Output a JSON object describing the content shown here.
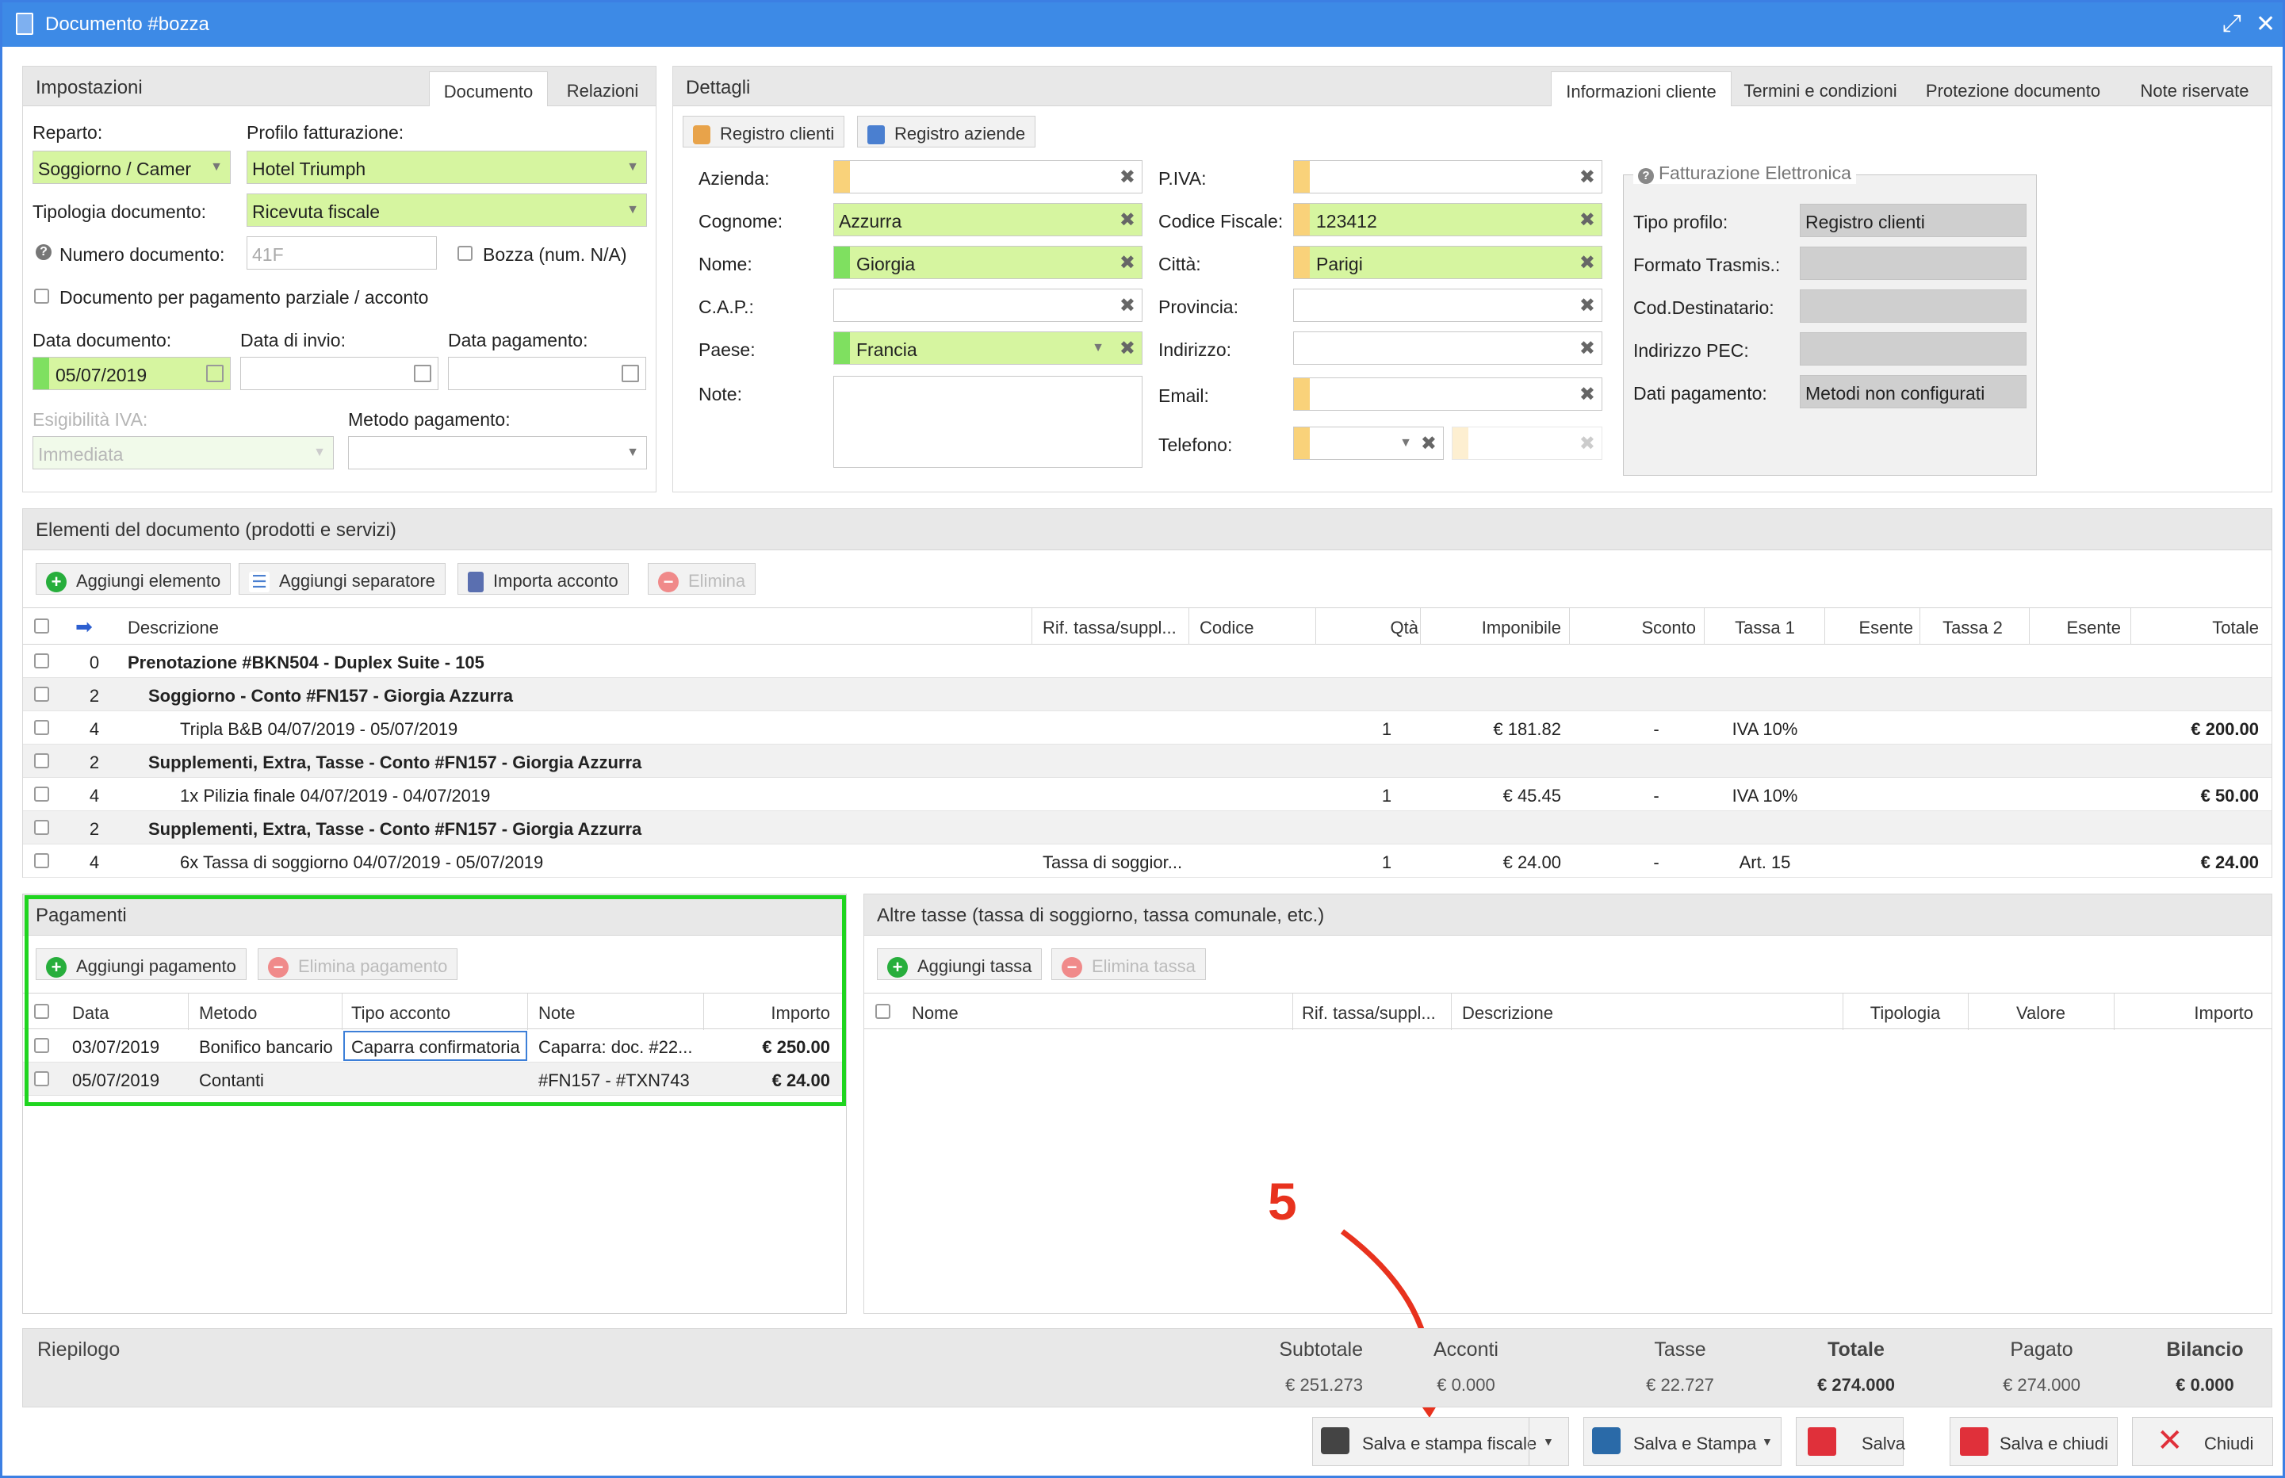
{
  "window": {
    "title": "Documento #bozza"
  },
  "impostazioni": {
    "title": "Impostazioni",
    "tabs": [
      "Documento",
      "Relazioni"
    ],
    "reparto_label": "Reparto:",
    "reparto_value": "Soggiorno / Camer",
    "profilo_label": "Profilo fatturazione:",
    "profilo_value": "Hotel Triumph",
    "tipologia_label": "Tipologia documento:",
    "tipologia_value": "Ricevuta fiscale",
    "numero_label": "Numero documento:",
    "numero_placeholder": "41F",
    "bozza_label": "Bozza (num. N/A)",
    "parziale_label": "Documento per pagamento parziale / acconto",
    "data_doc_label": "Data documento:",
    "data_doc_value": "05/07/2019",
    "data_invio_label": "Data di invio:",
    "data_pagamento_label": "Data pagamento:",
    "esigibilita_label": "Esigibilità IVA:",
    "esigibilita_value": "Immediata",
    "metodo_label": "Metodo pagamento:"
  },
  "dettagli": {
    "title": "Dettagli",
    "tabs": [
      "Informazioni cliente",
      "Termini e condizioni",
      "Protezione documento",
      "Note riservate"
    ],
    "registro_clienti": "Registro clienti",
    "registro_aziende": "Registro aziende",
    "azienda_label": "Azienda:",
    "cognome_label": "Cognome:",
    "cognome_value": "Azzurra",
    "nome_label": "Nome:",
    "nome_value": "Giorgia",
    "cap_label": "C.A.P.:",
    "paese_label": "Paese:",
    "paese_value": "Francia",
    "note_label": "Note:",
    "piva_label": "P.IVA:",
    "cf_label": "Codice Fiscale:",
    "cf_value": "123412",
    "citta_label": "Città:",
    "citta_value": "Parigi",
    "provincia_label": "Provincia:",
    "indirizzo_label": "Indirizzo:",
    "email_label": "Email:",
    "telefono_label": "Telefono:",
    "fe": {
      "title": "Fatturazione Elettronica",
      "tipo_label": "Tipo profilo:",
      "tipo_value": "Registro clienti",
      "formato_label": "Formato Trasmis.:",
      "cod_label": "Cod.Destinatario:",
      "pec_label": "Indirizzo PEC:",
      "pagamento_label": "Dati pagamento:",
      "pagamento_value": "Metodi non configurati"
    }
  },
  "elementi": {
    "title": "Elementi del documento (prodotti e servizi)",
    "buttons": {
      "add": "Aggiungi elemento",
      "sep": "Aggiungi separatore",
      "import": "Importa acconto",
      "del": "Elimina"
    },
    "headers": {
      "descr": "Descrizione",
      "rif": "Rif. tassa/suppl...",
      "codice": "Codice",
      "qta": "Qtà",
      "imponibile": "Imponibile",
      "sconto": "Sconto",
      "tassa1": "Tassa 1",
      "esente1": "Esente",
      "tassa2": "Tassa 2",
      "esente2": "Esente",
      "totale": "Totale"
    },
    "rows": [
      {
        "lvl": "0",
        "descr": "Prenotazione #BKN504 - Duplex Suite - 105",
        "bold": true,
        "indent": 0,
        "alt": false
      },
      {
        "lvl": "2",
        "descr": "Soggiorno - Conto #FN157 - Giorgia Azzurra",
        "bold": true,
        "indent": 1,
        "alt": true
      },
      {
        "lvl": "4",
        "descr": "Tripla B&B 04/07/2019 - 05/07/2019",
        "indent": 2,
        "alt": false,
        "qta": "1",
        "imponibile": "€ 181.82",
        "sconto": "-",
        "tassa1": "IVA 10%",
        "totale": "€ 200.00"
      },
      {
        "lvl": "2",
        "descr": "Supplementi, Extra, Tasse - Conto #FN157 - Giorgia Azzurra",
        "bold": true,
        "indent": 1,
        "alt": true
      },
      {
        "lvl": "4",
        "descr": "1x Pilizia finale 04/07/2019 - 04/07/2019",
        "indent": 2,
        "alt": false,
        "qta": "1",
        "imponibile": "€ 45.45",
        "sconto": "-",
        "tassa1": "IVA 10%",
        "totale": "€ 50.00"
      },
      {
        "lvl": "2",
        "descr": "Supplementi, Extra, Tasse - Conto #FN157 - Giorgia Azzurra",
        "bold": true,
        "indent": 1,
        "alt": true
      },
      {
        "lvl": "4",
        "descr": "6x Tassa di soggiorno 04/07/2019 - 05/07/2019",
        "indent": 2,
        "alt": false,
        "rif": "Tassa di soggior...",
        "qta": "1",
        "imponibile": "€ 24.00",
        "sconto": "-",
        "tassa1": "Art. 15",
        "totale": "€ 24.00"
      }
    ]
  },
  "pagamenti": {
    "title": "Pagamenti",
    "add": "Aggiungi pagamento",
    "del": "Elimina pagamento",
    "headers": {
      "data": "Data",
      "metodo": "Metodo",
      "tipo": "Tipo acconto",
      "note": "Note",
      "importo": "Importo"
    },
    "rows": [
      {
        "data": "03/07/2019",
        "metodo": "Bonifico bancario",
        "tipo": "Caparra confirmatoria",
        "note": "Caparra: doc. #22...",
        "importo": "€ 250.00"
      },
      {
        "data": "05/07/2019",
        "metodo": "Contanti",
        "tipo": "",
        "note": "#FN157 - #TXN743",
        "importo": "€ 24.00"
      }
    ]
  },
  "altre": {
    "title": "Altre tasse (tassa di soggiorno, tassa comunale, etc.)",
    "add": "Aggiungi tassa",
    "del": "Elimina tassa",
    "headers": {
      "nome": "Nome",
      "rif": "Rif. tassa/suppl...",
      "descr": "Descrizione",
      "tipologia": "Tipologia",
      "valore": "Valore",
      "importo": "Importo"
    }
  },
  "annotation": {
    "step": "5",
    "color": "#e8321e"
  },
  "riepilogo": {
    "title": "Riepilogo",
    "subtotale_l": "Subtotale",
    "subtotale_v": "€ 251.273",
    "acconti_l": "Acconti",
    "acconti_v": "€ 0.000",
    "tasse_l": "Tasse",
    "tasse_v": "€ 22.727",
    "totale_l": "Totale",
    "totale_v": "€ 274.000",
    "pagato_l": "Pagato",
    "pagato_v": "€ 274.000",
    "bilancio_l": "Bilancio",
    "bilancio_v": "€ 0.000"
  },
  "footer": {
    "salva_fiscale": "Salva e stampa fiscale",
    "salva_stampa": "Salva e Stampa",
    "salva": "Salva",
    "salva_chiudi": "Salva e chiudi",
    "chiudi": "Chiudi"
  },
  "colors": {
    "accent": "#3d8ae6",
    "green_field": "#d6f5a0",
    "highlight": "#1fd51f"
  }
}
